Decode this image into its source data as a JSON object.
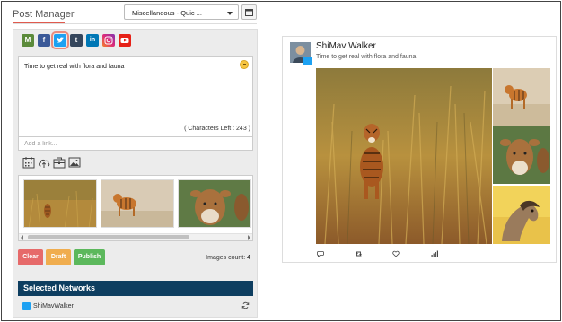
{
  "header": {
    "title": "Post Manager",
    "dropdown_value": "Miscellaneous - Quic ..."
  },
  "social_networks": [
    {
      "name": "M",
      "color": "#5b8a3a"
    },
    {
      "name": "f",
      "color": "#3b5998"
    },
    {
      "name": "t-bird",
      "color": "#1da1f2",
      "selected": true
    },
    {
      "name": "t",
      "color": "#35465c"
    },
    {
      "name": "in",
      "color": "#0077b5"
    },
    {
      "name": "ig",
      "color": "#c13584"
    },
    {
      "name": "yt",
      "color": "#e62117"
    }
  ],
  "composer": {
    "text": "Time to get real with flora and fauna",
    "chars_left": "( Characters Left : 243 )"
  },
  "link_input": {
    "placeholder": "Add a link...",
    "value": ""
  },
  "buttons": {
    "clear": "Clear",
    "draft": "Draft",
    "publish": "Publish"
  },
  "images_count": {
    "label": "Images count:",
    "value": "4"
  },
  "selected_networks": {
    "title": "Selected Networks",
    "items": [
      {
        "name": "ShiMavWalker",
        "network": "twitter"
      }
    ]
  },
  "preview": {
    "name": "ShiMav Walker",
    "text": "Time to get real with flora and fauna"
  },
  "colors": {
    "clear": "#e66a6a",
    "draft": "#f0ad4e",
    "publish": "#5cb85c",
    "networks_bar": "#0e3e60",
    "twitter": "#1da1f2"
  }
}
